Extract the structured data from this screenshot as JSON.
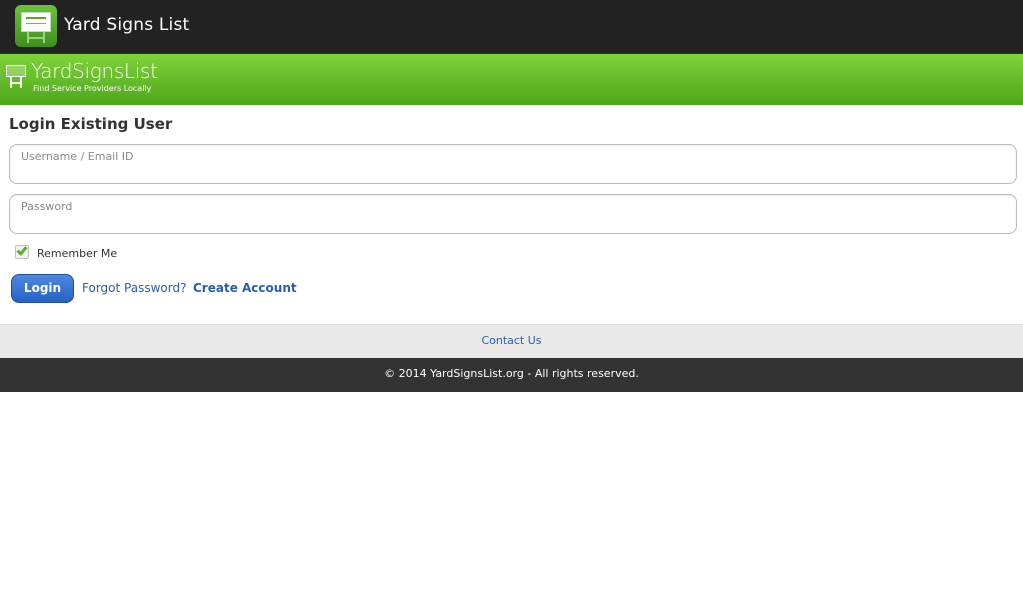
{
  "appbar": {
    "title": "Yard Signs List",
    "background": "#222222"
  },
  "banner": {
    "logo_text": "YardSignsList",
    "tagline": "Find Service Providers Locally",
    "color": "#5cb82a"
  },
  "login": {
    "heading": "Login Existing User",
    "username_placeholder": "Username / Email ID",
    "username_value": "",
    "password_placeholder": "Password",
    "password_value": "",
    "remember_label": "Remember Me",
    "remember_checked": true,
    "login_button": "Login",
    "forgot_link": "Forgot Password?",
    "create_link": "Create Account"
  },
  "footer": {
    "contact_link": "Contact Us",
    "copyright": "© 2014 YardSignsList.org - All rights reserved."
  },
  "colors": {
    "link": "#2a5db0",
    "button": "#2f6fd0",
    "check": "#5aae2a"
  }
}
